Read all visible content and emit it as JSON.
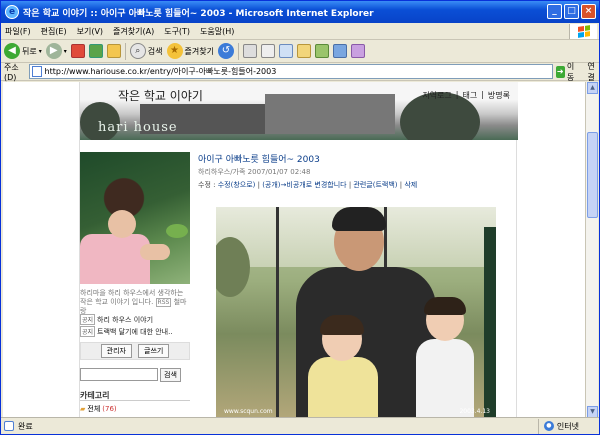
{
  "window": {
    "title": "작은 학교 이야기 :: 아이구 아빠노릇 힘들어~ 2003 - Microsoft Internet Explorer"
  },
  "menu": [
    "파일(F)",
    "편집(E)",
    "보기(V)",
    "즐겨찾기(A)",
    "도구(T)",
    "도움말(H)"
  ],
  "toolbar": {
    "back": "뒤로",
    "search": "검색",
    "favorites": "즐겨찾기"
  },
  "address": {
    "label": "주소(D)",
    "url": "http://www.hariouse.co.kr/entry/아이구-아빠노릇-힘들어-2003",
    "go": "이동",
    "links": "연결"
  },
  "banner": {
    "blog_title": "작은 학교 이야기",
    "brand": "hari house",
    "links": [
      "지역로그",
      "태그",
      "방명록"
    ],
    "separator": "|"
  },
  "sidebar": {
    "description": "하리마을 하리 하우스에서 생각하는 작은 학교 이야기 입니다.",
    "rss": "RSS",
    "rss_suffix": "철마랑",
    "notices": [
      {
        "tag": "공지",
        "label": "하리 하우스 이야기"
      },
      {
        "tag": "공지",
        "label": "트랙백 달기에 대한 안내.."
      }
    ],
    "admin_button": "관리자",
    "write_button": "글쓰기",
    "search_button": "검색",
    "category_title": "카테고리",
    "category_item": {
      "label": "전체",
      "count": "(76)"
    }
  },
  "post": {
    "title": "아이구 아빠노릇 힘들어~ 2003",
    "meta": "하리하우스/가족   2007/01/07 02:48",
    "actions_prefix": "수정 : ",
    "actions": [
      "수정(창으로)",
      "(공개)→비공개로 변경합니다",
      "관련글(트랙백)",
      "삭제"
    ],
    "photo_watermark": "www.scqun.com",
    "photo_date": "2003.4.13"
  },
  "status": {
    "text": "완료",
    "zone": "인터넷"
  }
}
